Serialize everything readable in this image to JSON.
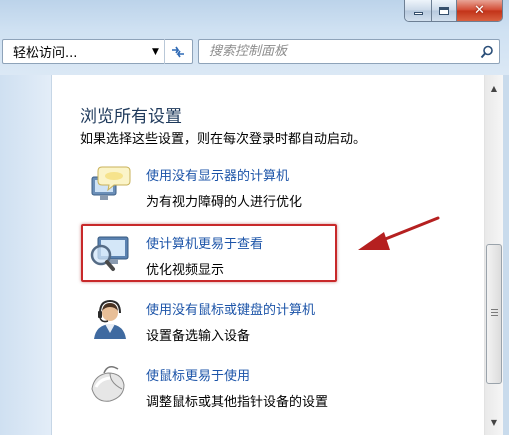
{
  "address": {
    "text": "轻松访问..."
  },
  "search": {
    "placeholder": "搜索控制面板"
  },
  "content": {
    "title": "浏览所有设置",
    "subtitle": "如果选择这些设置，则在每次登录时都自动启动。",
    "items": [
      {
        "link": "使用没有显示器的计算机",
        "desc": "为有视力障碍的人进行优化",
        "icon": "speech-bubble-monitor-icon"
      },
      {
        "link": "使计算机更易于查看",
        "desc": "优化视频显示",
        "icon": "magnifier-monitor-icon"
      },
      {
        "link": "使用没有鼠标或键盘的计算机",
        "desc": "设置备选输入设备",
        "icon": "user-headset-icon"
      },
      {
        "link": "使鼠标更易于使用",
        "desc": "调整鼠标或其他指针设备的设置",
        "icon": "mouse-icon"
      }
    ]
  },
  "annotation": {
    "highlight_color": "#c8292a"
  }
}
